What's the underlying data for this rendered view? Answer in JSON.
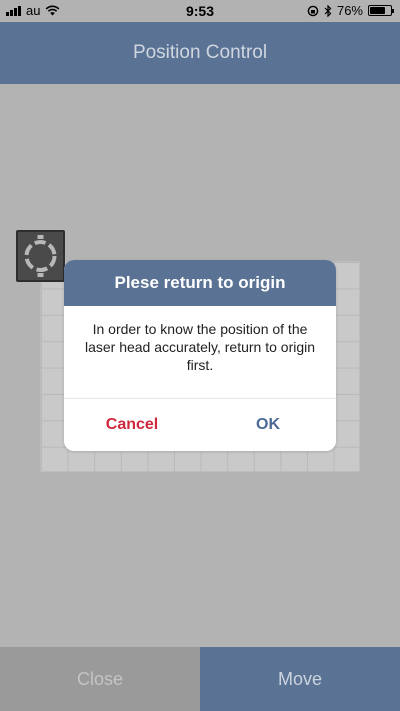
{
  "status_bar": {
    "carrier": "au",
    "time": "9:53",
    "battery": "76%",
    "battery_level": 0.76
  },
  "nav": {
    "title": "Position Control"
  },
  "dialog": {
    "title": "Plese return to origin",
    "message": "In order to know the position of the laser head accurately, return to origin first.",
    "cancel_label": "Cancel",
    "ok_label": "OK"
  },
  "bottom": {
    "close_label": "Close",
    "move_label": "Move"
  },
  "colors": {
    "nav": "#5a7293",
    "cancel": "#d0283c",
    "ok": "#4a6a95"
  },
  "icons": [
    "signal-icon",
    "wifi-icon",
    "orientation-lock-icon",
    "bluetooth-icon",
    "battery-icon",
    "laser-head-icon"
  ]
}
